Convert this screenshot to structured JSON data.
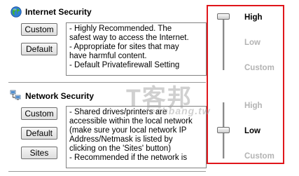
{
  "internet_security": {
    "icon": "globe-icon",
    "title": "Internet Security",
    "buttons": {
      "custom": "Custom",
      "default": "Default"
    },
    "description": [
      "- Highly Recommended. The",
      "safest way to access the Internet.",
      "- Appropriate for sites that may",
      "have harmful content.",
      "- Default Privatefirewall Setting"
    ],
    "slider": {
      "levels": [
        "High",
        "Low",
        "Custom"
      ],
      "selected": "High"
    }
  },
  "network_security": {
    "icon": "network-computers-icon",
    "title": "Network Security",
    "buttons": {
      "custom": "Custom",
      "default": "Default",
      "sites": "Sites"
    },
    "description": [
      "- Shared drives/printers are",
      "accessible within the local network",
      "(make sure your local network IP",
      "Address/Netmask is listed by",
      "clicking on the 'Sites' button)",
      "- Recommended if the network is"
    ],
    "slider": {
      "levels": [
        "High",
        "Low",
        "Custom"
      ],
      "selected": "Low"
    }
  },
  "watermark": {
    "text": "T客邦",
    "url": "techbang.tw"
  },
  "colors": {
    "highlight_border": "#e0161b",
    "inactive_level": "#b3b3b3"
  }
}
